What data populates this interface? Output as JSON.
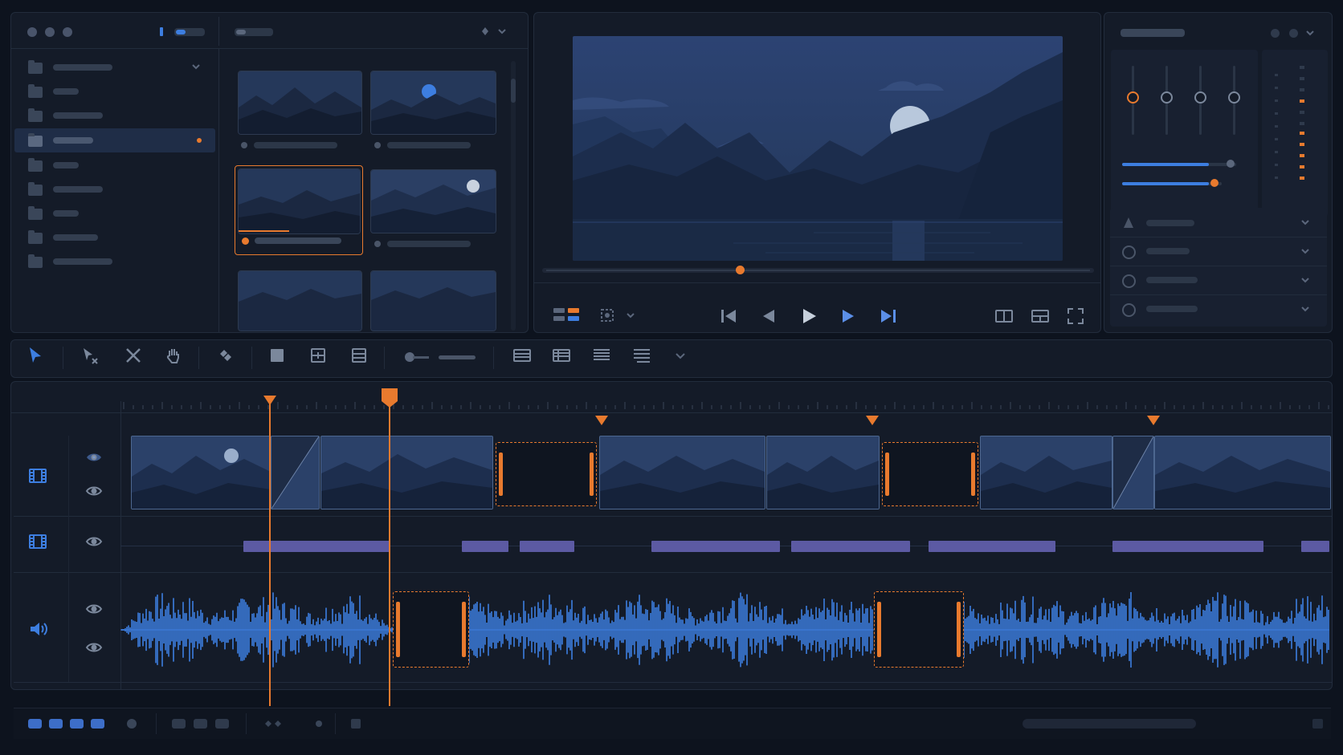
{
  "window": {
    "title": "",
    "traffic_lights": [
      "close",
      "minimize",
      "zoom"
    ]
  },
  "media_browser": {
    "folders": [
      {
        "label": "",
        "selected": false,
        "expanded": true
      },
      {
        "label": "",
        "selected": false
      },
      {
        "label": "",
        "selected": false
      },
      {
        "label": "",
        "selected": true,
        "badge": "orange-dot"
      },
      {
        "label": "",
        "selected": false
      },
      {
        "label": "",
        "selected": false
      },
      {
        "label": "",
        "selected": false
      },
      {
        "label": "",
        "selected": false
      },
      {
        "label": "",
        "selected": false
      }
    ],
    "clips": [
      {
        "name": "",
        "selected": false,
        "has_moon": false
      },
      {
        "name": "",
        "selected": false,
        "has_moon": true
      },
      {
        "name": "",
        "selected": true,
        "has_moon": false,
        "progress": 0.42
      },
      {
        "name": "",
        "selected": false,
        "has_moon": true
      },
      {
        "name": "",
        "selected": false,
        "has_moon": false
      },
      {
        "name": "",
        "selected": false,
        "has_moon": false
      }
    ]
  },
  "viewer": {
    "scene": "moonlit-mountain-lake",
    "playhead_position": 0.37,
    "controls": [
      "skip-to-start-icon",
      "step-back-icon",
      "play-icon",
      "step-forward-icon",
      "skip-to-end-icon"
    ],
    "view_buttons": [
      "single-view-icon",
      "split-view-icon",
      "fullscreen-icon"
    ]
  },
  "inspector": {
    "title": "",
    "faders": [
      {
        "level": 0.7,
        "accent": true
      },
      {
        "level": 0.7
      },
      {
        "level": 0.7
      },
      {
        "level": 0.7
      }
    ],
    "sliders": [
      {
        "value": 0.82,
        "accent": false
      },
      {
        "value": 0.68,
        "accent": true
      }
    ],
    "properties": [
      {
        "label": "",
        "icon": "tree-icon"
      },
      {
        "label": "",
        "icon": "circle-icon"
      },
      {
        "label": "",
        "icon": "circle-icon"
      },
      {
        "label": "",
        "icon": "circle-icon"
      }
    ]
  },
  "toolbar": {
    "tools": [
      "select-tool-icon",
      "trim-tool-icon",
      "blade-tool-icon",
      "hand-tool-icon",
      "link-tool-icon",
      "square-tool-icon",
      "box-tool-icon",
      "stack-tool-icon"
    ],
    "active_tool": "select-tool-icon",
    "zoom_level": 0.4
  },
  "timeline": {
    "playhead_position": 0.29,
    "markers": [
      0.195,
      0.4,
      0.62,
      0.8
    ],
    "tracks": [
      {
        "type": "video",
        "icon": "film-icon",
        "visible": true
      },
      {
        "type": "video",
        "icon": "film-icon",
        "visible": true
      },
      {
        "type": "audio",
        "icon": "speaker-icon",
        "visible": true
      }
    ],
    "accent_color": "#e87a2e",
    "clip_color": "#2a3f63",
    "waveform_color": "#3d7ee0",
    "title_bar_color": "#5c5aa3"
  },
  "status_bar": {
    "items": 0
  }
}
